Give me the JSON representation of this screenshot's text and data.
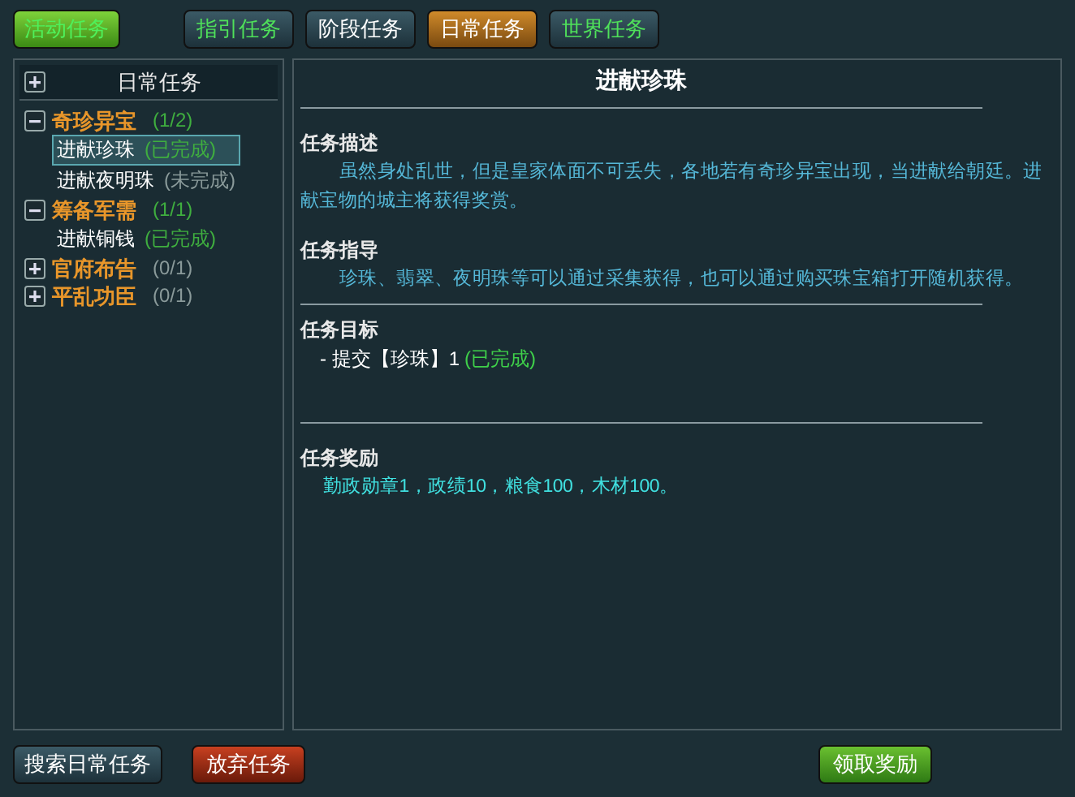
{
  "activity_button": {
    "label": "活动任务"
  },
  "tabs": [
    {
      "label": "指引任务",
      "selected": false,
      "color": "#4fe05a"
    },
    {
      "label": "阶段任务",
      "selected": false,
      "color": "#ffffff"
    },
    {
      "label": "日常任务",
      "selected": true,
      "color": "#ffffff"
    },
    {
      "label": "世界任务",
      "selected": false,
      "color": "#4fe05a"
    }
  ],
  "sidebar": {
    "title": "日常任务",
    "expanded": false,
    "groups": [
      {
        "title": "奇珍异宝",
        "progress": "(1/2)",
        "complete": true,
        "expanded": true,
        "children": [
          {
            "name": "进献珍珠",
            "status": "(已完成)",
            "done": true,
            "selected": true
          },
          {
            "name": "进献夜明珠",
            "status": "(未完成)",
            "done": false,
            "selected": false
          }
        ]
      },
      {
        "title": "筹备军需",
        "progress": "(1/1)",
        "complete": true,
        "expanded": true,
        "children": [
          {
            "name": "进献铜钱",
            "status": "(已完成)",
            "done": true,
            "selected": false
          }
        ]
      },
      {
        "title": "官府布告",
        "progress": "(0/1)",
        "complete": false,
        "expanded": false
      },
      {
        "title": "平乱功臣",
        "progress": "(0/1)",
        "complete": false,
        "expanded": false
      }
    ]
  },
  "detail": {
    "title": "进献珍珠",
    "description": {
      "heading": "任务描述",
      "text": "虽然身处乱世，但是皇家体面不可丢失，各地若有奇珍异宝出现，当进献给朝廷。进献宝物的城主将获得奖赏。"
    },
    "guide": {
      "heading": "任务指导",
      "text": "珍珠、翡翠、夜明珠等可以通过采集获得，也可以通过购买珠宝箱打开随机获得。"
    },
    "goal": {
      "heading": "任务目标",
      "item": "- 提交【珍珠】1",
      "status": "(已完成)",
      "done": true
    },
    "reward": {
      "heading": "任务奖励",
      "text": "勤政勋章1，政绩10，粮食100，木材100。"
    }
  },
  "buttons": {
    "search": "搜索日常任务",
    "abandon": "放弃任务",
    "claim": "领取奖励"
  }
}
